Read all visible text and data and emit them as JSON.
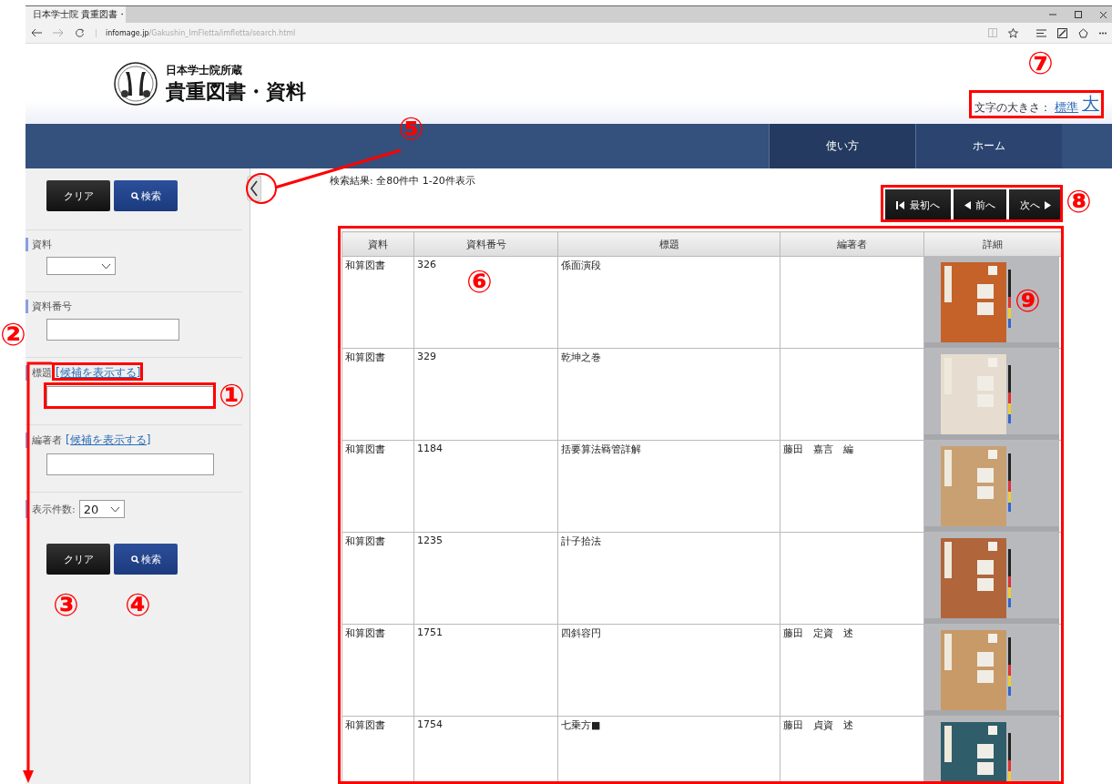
{
  "browser": {
    "tab_title": "日本学士院 貴重図書・",
    "url": {
      "host": "infomage.jp",
      "path": "/Gakushin_ImFletta/imfletta/search.html"
    }
  },
  "header": {
    "org": "日本学士院所蔵",
    "title": "貴重図書・資料",
    "font_size": {
      "label": "文字の大きさ：",
      "options": [
        {
          "label": "標準",
          "kind": "normal"
        },
        {
          "label": "大",
          "kind": "large"
        }
      ]
    }
  },
  "nav": [
    "使い方",
    "ホーム"
  ],
  "sidebar": {
    "top_buttons": [
      {
        "label": "クリア",
        "kind": "clear"
      },
      {
        "label": "検索",
        "kind": "search"
      }
    ],
    "fields": [
      {
        "label": "資料",
        "kind": "select"
      },
      {
        "label": "資料番号",
        "kind": "text"
      },
      {
        "label": "標題",
        "kind": "text",
        "link": "[候補を表示する]"
      },
      {
        "label": "編著者",
        "kind": "text",
        "link": "[候補を表示する]"
      },
      {
        "label": "表示件数:",
        "kind": "select",
        "value": "20"
      }
    ],
    "bottom_buttons": [
      {
        "label": "クリア",
        "kind": "clear"
      },
      {
        "label": "検索",
        "kind": "search"
      }
    ]
  },
  "results": {
    "summary": "検索結果: 全80件中 1-20件表示",
    "pager": [
      {
        "label": "最初へ",
        "kind": "first"
      },
      {
        "label": "前へ",
        "kind": "prev"
      },
      {
        "label": "次へ",
        "kind": "next"
      }
    ]
  },
  "table": {
    "columns": [
      "資料",
      "資料番号",
      "標題",
      "編著者",
      "詳細"
    ],
    "rows": [
      {
        "type": "和算図書",
        "number": "326",
        "title": "係面演段"
      },
      {
        "type": "和算図書",
        "number": "329",
        "title": "乾坤之巻"
      },
      {
        "type": "和算図書",
        "number": "1184",
        "title": "括要算法羇管詳解",
        "author": "藤田　嘉言　編"
      },
      {
        "type": "和算図書",
        "number": "1235",
        "title": "計子拾法"
      },
      {
        "type": "和算図書",
        "number": "1751",
        "title": "四斜容円",
        "author": "藤田　定資　述"
      },
      {
        "type": "和算図書",
        "number": "1754",
        "title": "七乗方■",
        "author": "藤田　貞資　述"
      }
    ]
  },
  "annotations": [
    "⑦",
    "⑤",
    "⑧",
    "⑥",
    "⑨",
    "②",
    "①",
    "③",
    "④"
  ]
}
